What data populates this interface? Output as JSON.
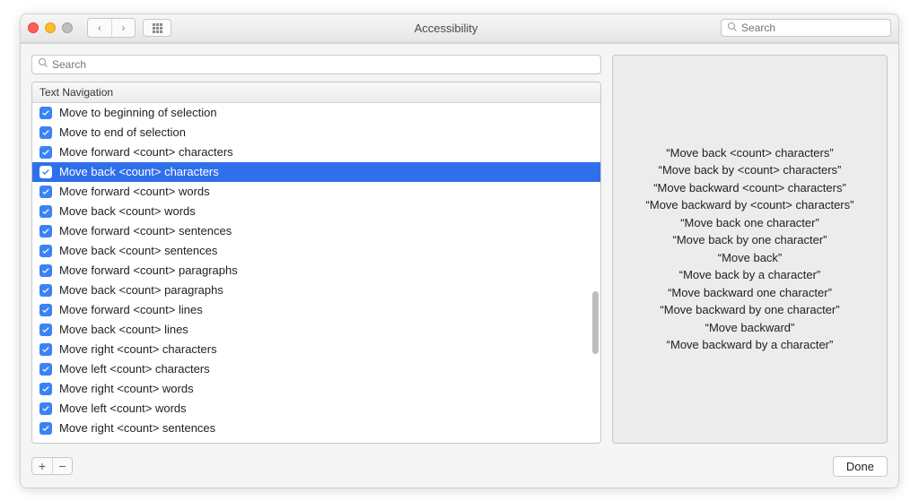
{
  "titlebar": {
    "title": "Accessibility",
    "search_placeholder": "Search"
  },
  "sheet": {
    "search_placeholder": "Search",
    "list_header": "Text Navigation",
    "items": [
      {
        "label": "Move to beginning of selection",
        "checked": true,
        "selected": false
      },
      {
        "label": "Move to end of selection",
        "checked": true,
        "selected": false
      },
      {
        "label": "Move forward <count> characters",
        "checked": true,
        "selected": false
      },
      {
        "label": "Move back <count> characters",
        "checked": true,
        "selected": true
      },
      {
        "label": "Move forward <count> words",
        "checked": true,
        "selected": false
      },
      {
        "label": "Move back <count> words",
        "checked": true,
        "selected": false
      },
      {
        "label": "Move forward <count> sentences",
        "checked": true,
        "selected": false
      },
      {
        "label": "Move back <count> sentences",
        "checked": true,
        "selected": false
      },
      {
        "label": "Move forward <count> paragraphs",
        "checked": true,
        "selected": false
      },
      {
        "label": "Move back <count> paragraphs",
        "checked": true,
        "selected": false
      },
      {
        "label": "Move forward <count> lines",
        "checked": true,
        "selected": false
      },
      {
        "label": "Move back <count> lines",
        "checked": true,
        "selected": false
      },
      {
        "label": "Move right <count> characters",
        "checked": true,
        "selected": false
      },
      {
        "label": "Move left <count> characters",
        "checked": true,
        "selected": false
      },
      {
        "label": "Move right <count> words",
        "checked": true,
        "selected": false
      },
      {
        "label": "Move left <count> words",
        "checked": true,
        "selected": false
      },
      {
        "label": "Move right <count> sentences",
        "checked": true,
        "selected": false
      }
    ],
    "phrases": [
      "“Move back <count> characters”",
      "“Move back by <count> characters”",
      "“Move backward <count> characters”",
      "“Move backward by <count> characters”",
      "“Move back one character”",
      "“Move back by one character”",
      "“Move back”",
      "“Move back by a character”",
      "“Move backward one character”",
      "“Move backward by one character”",
      "“Move backward”",
      "“Move backward by a character”"
    ],
    "add_label": "+",
    "remove_label": "−",
    "done_label": "Done"
  }
}
